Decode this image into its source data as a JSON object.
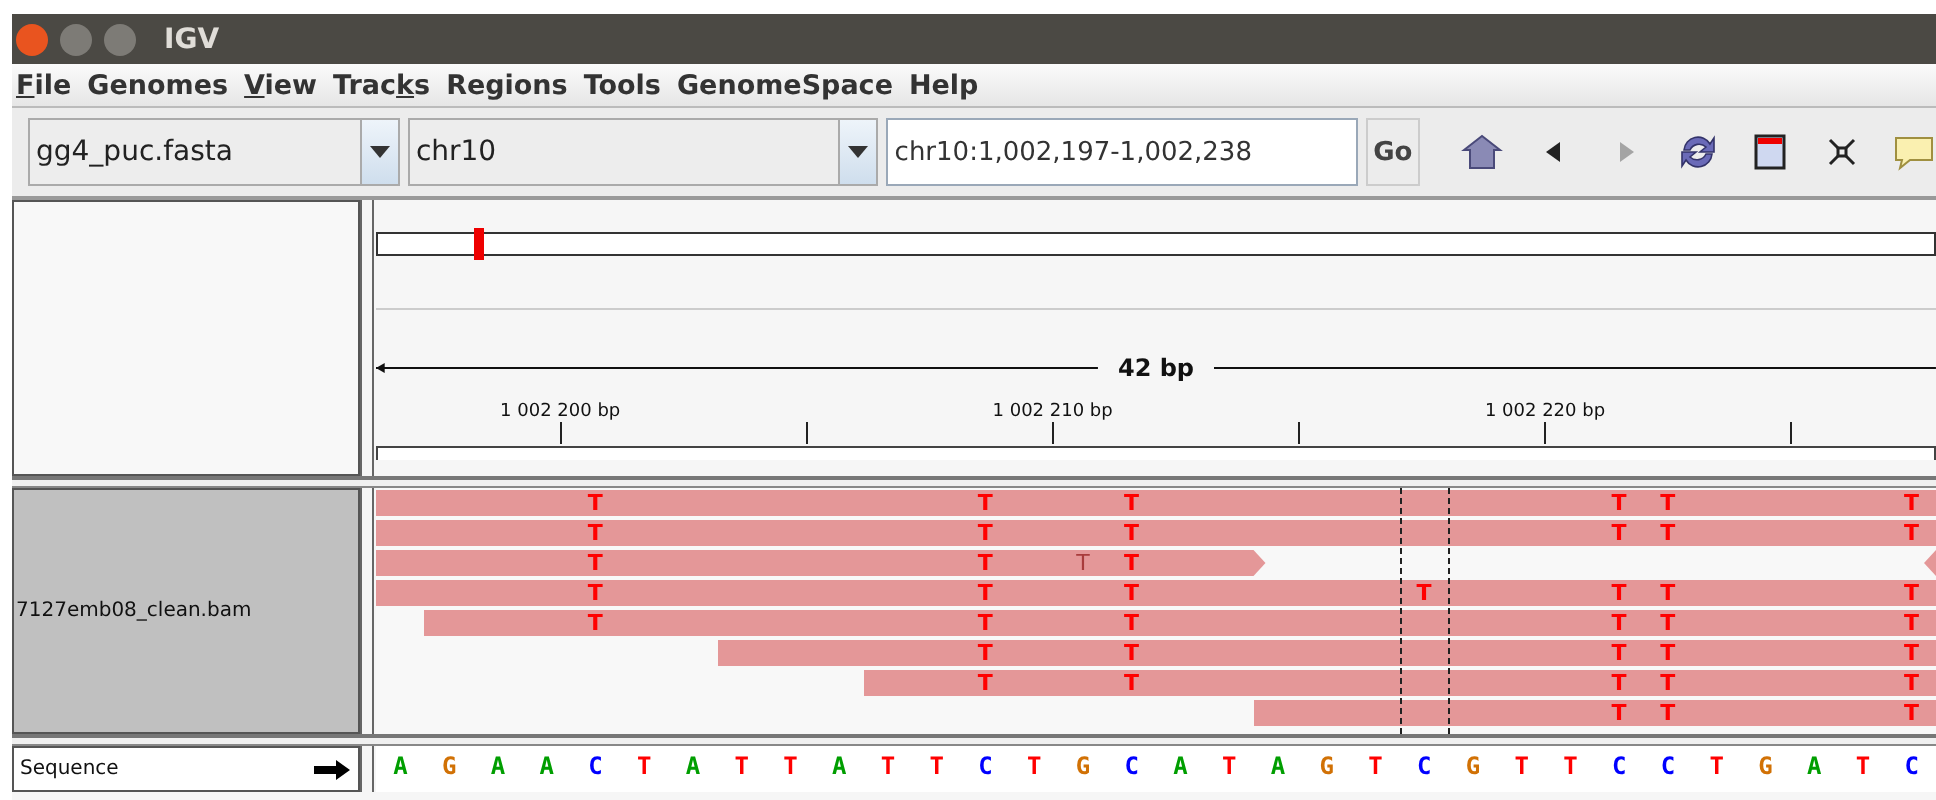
{
  "window": {
    "title": "IGV"
  },
  "menu": [
    {
      "key": "F",
      "post": "ile"
    },
    {
      "pre": "Genomes"
    },
    {
      "key": "V",
      "post": "iew"
    },
    {
      "pre": "Trac",
      "key": "k",
      "post": "s"
    },
    {
      "pre": "Regions"
    },
    {
      "pre": "Tools"
    },
    {
      "pre": "GenomeSpace"
    },
    {
      "pre": "Help"
    }
  ],
  "toolbar": {
    "genome": "gg4_puc.fasta",
    "chromosome": "chr10",
    "locus": "chr10:1,002,197-1,002,238",
    "go": "Go",
    "tools": [
      {
        "kind": "home",
        "disabled": false
      },
      {
        "kind": "back",
        "disabled": false
      },
      {
        "kind": "forward",
        "disabled": true
      },
      {
        "kind": "refresh",
        "disabled": false
      },
      {
        "kind": "region",
        "disabled": false
      },
      {
        "kind": "fit",
        "disabled": false
      },
      {
        "kind": "popup",
        "disabled": false
      }
    ]
  },
  "ruler": {
    "span": "42 bp",
    "labels": [
      "1 002 200 bp",
      "1 002 210 bp",
      "1 002 220 bp"
    ]
  },
  "alignment_track": {
    "name": "7127emb08_clean.bam",
    "rows": [
      {
        "next_read_tip": false,
        "cells": [
          {
            "kind": "match"
          },
          {
            "kind": "match"
          },
          {
            "kind": "match"
          },
          {
            "kind": "match"
          },
          {
            "kind": "mismatch",
            "base": "T",
            "faded": false
          },
          {
            "kind": "match"
          },
          {
            "kind": "match"
          },
          {
            "kind": "match"
          },
          {
            "kind": "match"
          },
          {
            "kind": "match"
          },
          {
            "kind": "match"
          },
          {
            "kind": "match"
          },
          {
            "kind": "mismatch",
            "base": "T",
            "faded": false
          },
          {
            "kind": "match"
          },
          {
            "kind": "match"
          },
          {
            "kind": "mismatch",
            "base": "T",
            "faded": false
          },
          {
            "kind": "match"
          },
          {
            "kind": "match"
          },
          {
            "kind": "match"
          },
          {
            "kind": "match"
          },
          {
            "kind": "match"
          },
          {
            "kind": "match"
          },
          {
            "kind": "match"
          },
          {
            "kind": "match"
          },
          {
            "kind": "match"
          },
          {
            "kind": "mismatch",
            "base": "T",
            "faded": false
          },
          {
            "kind": "mismatch",
            "base": "T",
            "faded": false
          },
          {
            "kind": "match"
          },
          {
            "kind": "match"
          },
          {
            "kind": "match"
          },
          {
            "kind": "match"
          },
          {
            "kind": "mismatch",
            "base": "T",
            "faded": false
          }
        ]
      },
      {
        "next_read_tip": false,
        "cells": [
          {
            "kind": "match"
          },
          {
            "kind": "match"
          },
          {
            "kind": "match"
          },
          {
            "kind": "match"
          },
          {
            "kind": "mismatch",
            "base": "T",
            "faded": false
          },
          {
            "kind": "match"
          },
          {
            "kind": "match"
          },
          {
            "kind": "match"
          },
          {
            "kind": "match"
          },
          {
            "kind": "match"
          },
          {
            "kind": "match"
          },
          {
            "kind": "match"
          },
          {
            "kind": "mismatch",
            "base": "T",
            "faded": false
          },
          {
            "kind": "match"
          },
          {
            "kind": "match"
          },
          {
            "kind": "mismatch",
            "base": "T",
            "faded": false
          },
          {
            "kind": "match"
          },
          {
            "kind": "match"
          },
          {
            "kind": "match"
          },
          {
            "kind": "match"
          },
          {
            "kind": "match"
          },
          {
            "kind": "match"
          },
          {
            "kind": "match"
          },
          {
            "kind": "match"
          },
          {
            "kind": "match"
          },
          {
            "kind": "mismatch",
            "base": "T",
            "faded": false
          },
          {
            "kind": "mismatch",
            "base": "T",
            "faded": false
          },
          {
            "kind": "match"
          },
          {
            "kind": "match"
          },
          {
            "kind": "match"
          },
          {
            "kind": "match"
          },
          {
            "kind": "mismatch",
            "base": "T",
            "faded": false
          }
        ]
      },
      {
        "next_read_tip": true,
        "cells": [
          {
            "kind": "match"
          },
          {
            "kind": "match"
          },
          {
            "kind": "match"
          },
          {
            "kind": "match"
          },
          {
            "kind": "mismatch",
            "base": "T",
            "faded": false
          },
          {
            "kind": "match"
          },
          {
            "kind": "match"
          },
          {
            "kind": "match"
          },
          {
            "kind": "match"
          },
          {
            "kind": "match"
          },
          {
            "kind": "match"
          },
          {
            "kind": "match"
          },
          {
            "kind": "mismatch",
            "base": "T",
            "faded": false
          },
          {
            "kind": "match"
          },
          {
            "kind": "mismatch",
            "base": "T",
            "faded": true
          },
          {
            "kind": "mismatch",
            "base": "T",
            "faded": false
          },
          {
            "kind": "match"
          },
          {
            "kind": "match"
          },
          {
            "kind": "gap"
          },
          {
            "kind": "gap"
          },
          {
            "kind": "gap"
          },
          {
            "kind": "gap"
          },
          {
            "kind": "gap"
          },
          {
            "kind": "gap"
          },
          {
            "kind": "gap"
          },
          {
            "kind": "gap"
          },
          {
            "kind": "gap"
          },
          {
            "kind": "gap"
          },
          {
            "kind": "gap"
          },
          {
            "kind": "gap"
          },
          {
            "kind": "gap"
          },
          {
            "kind": "gap"
          }
        ]
      },
      {
        "next_read_tip": false,
        "cells": [
          {
            "kind": "match"
          },
          {
            "kind": "match"
          },
          {
            "kind": "match"
          },
          {
            "kind": "match"
          },
          {
            "kind": "mismatch",
            "base": "T",
            "faded": false
          },
          {
            "kind": "match"
          },
          {
            "kind": "match"
          },
          {
            "kind": "match"
          },
          {
            "kind": "match"
          },
          {
            "kind": "match"
          },
          {
            "kind": "match"
          },
          {
            "kind": "match"
          },
          {
            "kind": "mismatch",
            "base": "T",
            "faded": false
          },
          {
            "kind": "match"
          },
          {
            "kind": "match"
          },
          {
            "kind": "mismatch",
            "base": "T",
            "faded": false
          },
          {
            "kind": "match"
          },
          {
            "kind": "match"
          },
          {
            "kind": "match"
          },
          {
            "kind": "match"
          },
          {
            "kind": "match"
          },
          {
            "kind": "mismatch",
            "base": "T",
            "faded": false
          },
          {
            "kind": "match"
          },
          {
            "kind": "match"
          },
          {
            "kind": "match"
          },
          {
            "kind": "mismatch",
            "base": "T",
            "faded": false
          },
          {
            "kind": "mismatch",
            "base": "T",
            "faded": false
          },
          {
            "kind": "match"
          },
          {
            "kind": "match"
          },
          {
            "kind": "match"
          },
          {
            "kind": "match"
          },
          {
            "kind": "mismatch",
            "base": "T",
            "faded": false
          }
        ]
      },
      {
        "next_read_tip": false,
        "cells": [
          {
            "kind": "gap"
          },
          {
            "kind": "match"
          },
          {
            "kind": "match"
          },
          {
            "kind": "match"
          },
          {
            "kind": "mismatch",
            "base": "T",
            "faded": false
          },
          {
            "kind": "match"
          },
          {
            "kind": "match"
          },
          {
            "kind": "match"
          },
          {
            "kind": "match"
          },
          {
            "kind": "match"
          },
          {
            "kind": "match"
          },
          {
            "kind": "match"
          },
          {
            "kind": "mismatch",
            "base": "T",
            "faded": false
          },
          {
            "kind": "match"
          },
          {
            "kind": "match"
          },
          {
            "kind": "mismatch",
            "base": "T",
            "faded": false
          },
          {
            "kind": "match"
          },
          {
            "kind": "match"
          },
          {
            "kind": "match"
          },
          {
            "kind": "match"
          },
          {
            "kind": "match"
          },
          {
            "kind": "match"
          },
          {
            "kind": "match"
          },
          {
            "kind": "match"
          },
          {
            "kind": "match"
          },
          {
            "kind": "mismatch",
            "base": "T",
            "faded": false
          },
          {
            "kind": "mismatch",
            "base": "T",
            "faded": false
          },
          {
            "kind": "match"
          },
          {
            "kind": "match"
          },
          {
            "kind": "match"
          },
          {
            "kind": "match"
          },
          {
            "kind": "mismatch",
            "base": "T",
            "faded": false
          }
        ]
      },
      {
        "next_read_tip": false,
        "cells": [
          {
            "kind": "gap"
          },
          {
            "kind": "gap"
          },
          {
            "kind": "gap"
          },
          {
            "kind": "gap"
          },
          {
            "kind": "gap"
          },
          {
            "kind": "gap"
          },
          {
            "kind": "gap"
          },
          {
            "kind": "match"
          },
          {
            "kind": "match"
          },
          {
            "kind": "match"
          },
          {
            "kind": "match"
          },
          {
            "kind": "match"
          },
          {
            "kind": "mismatch",
            "base": "T",
            "faded": false
          },
          {
            "kind": "match"
          },
          {
            "kind": "match"
          },
          {
            "kind": "mismatch",
            "base": "T",
            "faded": false
          },
          {
            "kind": "match"
          },
          {
            "kind": "match"
          },
          {
            "kind": "match"
          },
          {
            "kind": "match"
          },
          {
            "kind": "match"
          },
          {
            "kind": "match"
          },
          {
            "kind": "match"
          },
          {
            "kind": "match"
          },
          {
            "kind": "match"
          },
          {
            "kind": "mismatch",
            "base": "T",
            "faded": false
          },
          {
            "kind": "mismatch",
            "base": "T",
            "faded": false
          },
          {
            "kind": "match"
          },
          {
            "kind": "match"
          },
          {
            "kind": "match"
          },
          {
            "kind": "match"
          },
          {
            "kind": "mismatch",
            "base": "T",
            "faded": false
          }
        ]
      },
      {
        "next_read_tip": false,
        "cells": [
          {
            "kind": "gap"
          },
          {
            "kind": "gap"
          },
          {
            "kind": "gap"
          },
          {
            "kind": "gap"
          },
          {
            "kind": "gap"
          },
          {
            "kind": "gap"
          },
          {
            "kind": "gap"
          },
          {
            "kind": "gap"
          },
          {
            "kind": "gap"
          },
          {
            "kind": "gap"
          },
          {
            "kind": "match"
          },
          {
            "kind": "match"
          },
          {
            "kind": "mismatch",
            "base": "T",
            "faded": false
          },
          {
            "kind": "match"
          },
          {
            "kind": "match"
          },
          {
            "kind": "mismatch",
            "base": "T",
            "faded": false
          },
          {
            "kind": "match"
          },
          {
            "kind": "match"
          },
          {
            "kind": "match"
          },
          {
            "kind": "match"
          },
          {
            "kind": "match"
          },
          {
            "kind": "match"
          },
          {
            "kind": "match"
          },
          {
            "kind": "match"
          },
          {
            "kind": "match"
          },
          {
            "kind": "mismatch",
            "base": "T",
            "faded": false
          },
          {
            "kind": "mismatch",
            "base": "T",
            "faded": false
          },
          {
            "kind": "match"
          },
          {
            "kind": "match"
          },
          {
            "kind": "match"
          },
          {
            "kind": "match"
          },
          {
            "kind": "mismatch",
            "base": "T",
            "faded": false
          }
        ]
      },
      {
        "next_read_tip": false,
        "cells": [
          {
            "kind": "gap"
          },
          {
            "kind": "gap"
          },
          {
            "kind": "gap"
          },
          {
            "kind": "gap"
          },
          {
            "kind": "gap"
          },
          {
            "kind": "gap"
          },
          {
            "kind": "gap"
          },
          {
            "kind": "gap"
          },
          {
            "kind": "gap"
          },
          {
            "kind": "gap"
          },
          {
            "kind": "gap"
          },
          {
            "kind": "gap"
          },
          {
            "kind": "gap"
          },
          {
            "kind": "gap"
          },
          {
            "kind": "gap"
          },
          {
            "kind": "gap"
          },
          {
            "kind": "gap"
          },
          {
            "kind": "gap"
          },
          {
            "kind": "match"
          },
          {
            "kind": "match"
          },
          {
            "kind": "match"
          },
          {
            "kind": "match"
          },
          {
            "kind": "match"
          },
          {
            "kind": "match"
          },
          {
            "kind": "match"
          },
          {
            "kind": "mismatch",
            "base": "T",
            "faded": false
          },
          {
            "kind": "mismatch",
            "base": "T",
            "faded": false
          },
          {
            "kind": "match"
          },
          {
            "kind": "match"
          },
          {
            "kind": "match"
          },
          {
            "kind": "match"
          },
          {
            "kind": "mismatch",
            "base": "T",
            "faded": false
          }
        ]
      }
    ]
  },
  "sequence_track": {
    "name": "Sequence",
    "forward_strand": true,
    "bases": [
      {
        "base": "A",
        "color": "#009e00"
      },
      {
        "base": "G",
        "color": "#d17105"
      },
      {
        "base": "A",
        "color": "#009e00"
      },
      {
        "base": "A",
        "color": "#009e00"
      },
      {
        "base": "C",
        "color": "#0000ff"
      },
      {
        "base": "T",
        "color": "#ff0000"
      },
      {
        "base": "A",
        "color": "#009e00"
      },
      {
        "base": "T",
        "color": "#ff0000"
      },
      {
        "base": "T",
        "color": "#ff0000"
      },
      {
        "base": "A",
        "color": "#009e00"
      },
      {
        "base": "T",
        "color": "#ff0000"
      },
      {
        "base": "T",
        "color": "#ff0000"
      },
      {
        "base": "C",
        "color": "#0000ff"
      },
      {
        "base": "T",
        "color": "#ff0000"
      },
      {
        "base": "G",
        "color": "#d17105"
      },
      {
        "base": "C",
        "color": "#0000ff"
      },
      {
        "base": "A",
        "color": "#009e00"
      },
      {
        "base": "T",
        "color": "#ff0000"
      },
      {
        "base": "A",
        "color": "#009e00"
      },
      {
        "base": "G",
        "color": "#d17105"
      },
      {
        "base": "T",
        "color": "#ff0000"
      },
      {
        "base": "C",
        "color": "#0000ff"
      },
      {
        "base": "G",
        "color": "#d17105"
      },
      {
        "base": "T",
        "color": "#ff0000"
      },
      {
        "base": "T",
        "color": "#ff0000"
      },
      {
        "base": "C",
        "color": "#0000ff"
      },
      {
        "base": "C",
        "color": "#0000ff"
      },
      {
        "base": "T",
        "color": "#ff0000"
      },
      {
        "base": "G",
        "color": "#d17105"
      },
      {
        "base": "A",
        "color": "#009e00"
      },
      {
        "base": "T",
        "color": "#ff0000"
      },
      {
        "base": "C",
        "color": "#0000ff"
      }
    ]
  }
}
